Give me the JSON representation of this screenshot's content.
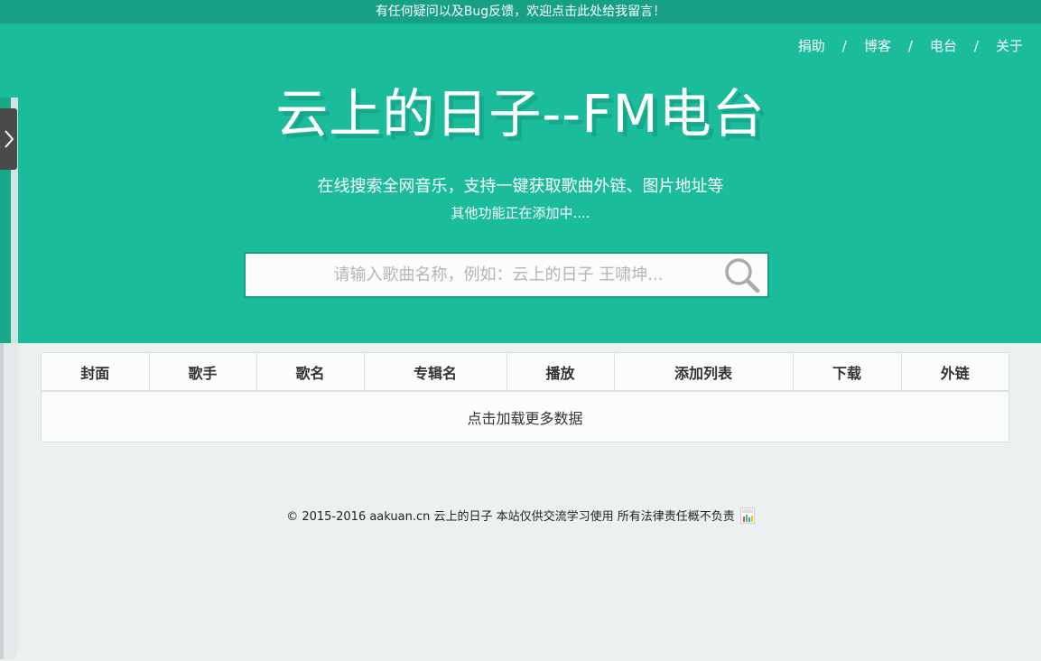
{
  "topbar": {
    "notice": "有任何疑问以及Bug反馈，欢迎点击此处给我留言！",
    "bg_color": "#16a085"
  },
  "hero": {
    "bg_color": "#1abc9c",
    "nav": [
      {
        "label": "捐助"
      },
      {
        "label": "博客"
      },
      {
        "label": "电台"
      },
      {
        "label": "关于"
      }
    ],
    "nav_separator": "/",
    "title": "云上的日子--FM电台",
    "subtitle": "在线搜索全网音乐，支持一键获取歌曲外链、图片地址等",
    "subtitle2": "其他功能正在添加中....",
    "search": {
      "placeholder": "请输入歌曲名称，例如：云上的日子 王啸坤...",
      "value": "",
      "icon": "search-icon"
    }
  },
  "side_tab": {
    "icon": "chevron-right-icon"
  },
  "table": {
    "headers": [
      "封面",
      "歌手",
      "歌名",
      "专辑名",
      "播放",
      "添加列表",
      "下载",
      "外链"
    ],
    "load_more": "点击加载更多数据"
  },
  "footer": {
    "text": "© 2015-2016 aakuan.cn 云上的日子 本站仅供交流学习使用 所有法律责任概不负责",
    "stat_icon": "cnzz-stats-icon"
  }
}
